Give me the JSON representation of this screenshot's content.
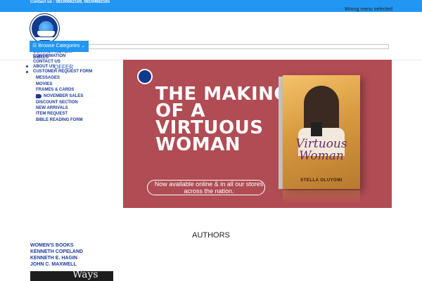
{
  "topbar": {
    "contact": "Contact us : 08100682169, 08100682165"
  },
  "header": {
    "wrong_menu": "Wrong menu selected",
    "browse_categories": "Browse Categories"
  },
  "menu": {
    "items": [
      "CONTACT HISTORY",
      "BIBLES",
      "CONFIRMATION",
      "CONTACT US",
      "ABOUT US",
      "CUSTOMER REQUEST FORM",
      "MESSAGES",
      "MOVIES",
      "FRAMES & CARDS",
      "NOVEMBER SALES",
      "DISCOUNT SECTION",
      "NEW ARRIVALS",
      "ITEM REQUEST",
      "BIBLE READING FORM"
    ],
    "offer": "OFFER"
  },
  "banner": {
    "headline": "THE MAKING OF A VIRTUOUS WOMAN",
    "subline": "Now available online & in all our stores across the nation.",
    "book_title": "Virtuous Woman",
    "book_author": "STELLA OLUYOMI"
  },
  "authors": {
    "heading": "AUTHORS",
    "items": [
      "WOMEN'S BOOKS",
      "KENNETH COPELAND",
      "KENNETH E. HAGIN",
      "JOHN C. MAXWELL"
    ]
  },
  "thumbnail": {
    "text": "Ways"
  }
}
